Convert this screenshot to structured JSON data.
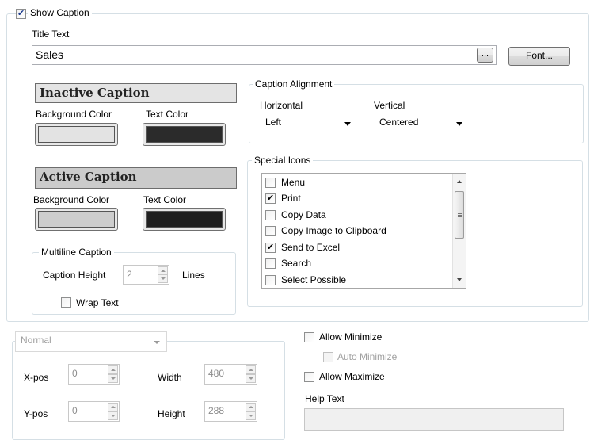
{
  "show_caption": {
    "label": "Show Caption",
    "checked": true
  },
  "title_text": {
    "label": "Title Text",
    "value": "Sales",
    "ellipsis_label": "...",
    "font_label": "Font..."
  },
  "inactive_caption": {
    "heading": "Inactive Caption",
    "background_label": "Background Color",
    "text_label": "Text Color",
    "background_color": "#e3e3e3",
    "text_color": "#2b2b2b"
  },
  "active_caption": {
    "heading": "Active Caption",
    "background_label": "Background Color",
    "text_label": "Text Color",
    "background_color": "#cdcdcd",
    "text_color": "#1f1f1f"
  },
  "multiline": {
    "legend": "Multiline Caption",
    "height_label": "Caption Height",
    "height_value": "2",
    "lines_label": "Lines",
    "wrap_label": "Wrap Text",
    "wrap_checked": false
  },
  "caption_alignment": {
    "legend": "Caption Alignment",
    "horizontal_label": "Horizontal",
    "horizontal_value": "Left",
    "vertical_label": "Vertical",
    "vertical_value": "Centered"
  },
  "special_icons": {
    "legend": "Special Icons",
    "items": [
      {
        "label": "Menu",
        "checked": false
      },
      {
        "label": "Print",
        "checked": true
      },
      {
        "label": "Copy Data",
        "checked": false
      },
      {
        "label": "Copy Image to Clipboard",
        "checked": false
      },
      {
        "label": "Send to Excel",
        "checked": true
      },
      {
        "label": "Search",
        "checked": false
      },
      {
        "label": "Select Possible",
        "checked": false
      }
    ]
  },
  "position": {
    "mode_value": "Normal",
    "xpos_label": "X-pos",
    "xpos_value": "0",
    "ypos_label": "Y-pos",
    "ypos_value": "0",
    "width_label": "Width",
    "width_value": "480",
    "height_label": "Height",
    "height_value": "288"
  },
  "options": {
    "allow_minimize": "Allow Minimize",
    "auto_minimize": "Auto Minimize",
    "allow_maximize": "Allow Maximize",
    "help_text_label": "Help Text",
    "help_text_value": ""
  },
  "check_mark": "✔",
  "colors": {
    "groupbox_border": "#d5dfe5",
    "field_border": "#abadb3"
  }
}
